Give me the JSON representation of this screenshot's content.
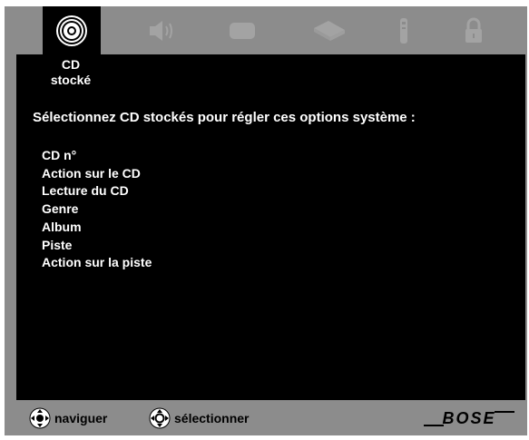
{
  "top_bar": {
    "icons": [
      {
        "name": "stored-cd-icon",
        "selected": true
      },
      {
        "name": "speaker-icon",
        "selected": false
      },
      {
        "name": "tv-icon",
        "selected": false
      },
      {
        "name": "media-device-icon",
        "selected": false
      },
      {
        "name": "remote-icon",
        "selected": false
      },
      {
        "name": "lock-icon",
        "selected": false
      }
    ],
    "selected_label_line1": "CD",
    "selected_label_line2": "stocké"
  },
  "main": {
    "heading": "Sélectionnez CD stockés pour régler ces options système :",
    "options": [
      "CD n°",
      "Action sur le CD",
      "Lecture du CD",
      "Genre",
      "Album",
      "Piste",
      "Action sur la piste"
    ]
  },
  "footer": {
    "navigate_label": "naviguer",
    "select_label": "sélectionner",
    "brand": "BOSE"
  },
  "colors": {
    "frame": "#8c8c8c",
    "screen": "#000000",
    "text": "#ffffff"
  }
}
